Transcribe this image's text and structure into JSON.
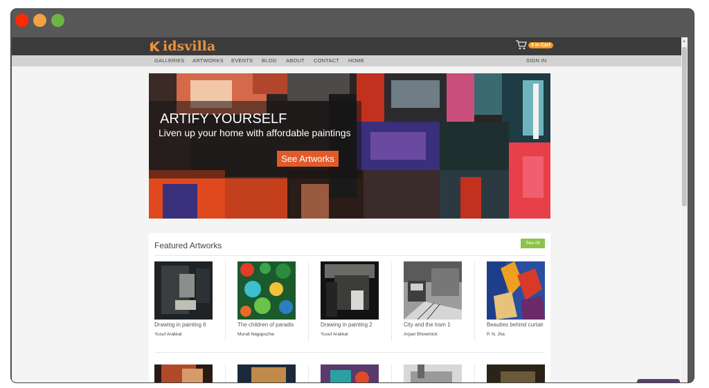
{
  "window": {
    "controls": [
      "close",
      "minimize",
      "maximize"
    ],
    "colors": {
      "close": "#ff2a00",
      "minimize": "#f1a244",
      "maximize": "#6cb543"
    }
  },
  "site": {
    "logo_text": "idsvilla",
    "cart_label": "0 in Cart",
    "nav": [
      "GALLERIES",
      "ARTWORKS",
      "EVENTS",
      "BLOG",
      "ABOUT",
      "CONTACT",
      "HOME"
    ],
    "sign_in": "SIGN IN"
  },
  "hero": {
    "title": "ARTIFY YOURSELF",
    "subtitle": "Liven up your home with affordable paintings",
    "button": "See Artworks"
  },
  "featured": {
    "heading": "Featured Artworks",
    "see_all": "See All",
    "artworks": [
      {
        "title": "Drawing in painting 6",
        "artist": "Yusuf Arakkal"
      },
      {
        "title": "The children of paradis",
        "artist": "Murali Nagapuzha"
      },
      {
        "title": "Drawing in painting 2",
        "artist": "Yusuf Arakkal"
      },
      {
        "title": "City and the tram 1",
        "artist": "Arpan Bhowmick"
      },
      {
        "title": "Beauties behind curtair",
        "artist": "P. N. Jha"
      }
    ]
  },
  "colors": {
    "accent_orange": "#e05b2b",
    "see_all_green": "#8bc34a",
    "logo_orange": "#e89240",
    "topbar": "#3b3b3b",
    "navbar": "#d2d2d2"
  }
}
